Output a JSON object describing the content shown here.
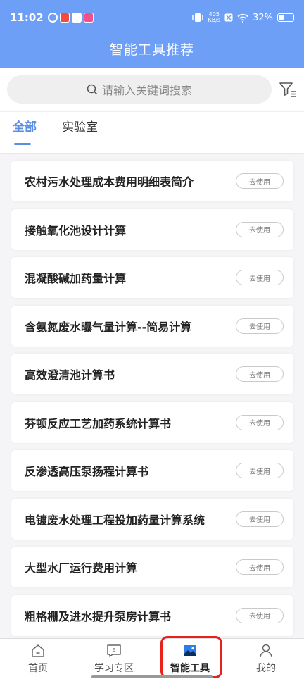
{
  "status_bar": {
    "time": "11:02",
    "speed_top": "405",
    "speed_unit": "KB/s",
    "battery": "32%"
  },
  "header": {
    "title": "智能工具推荐"
  },
  "search": {
    "placeholder": "请输入关键词搜索"
  },
  "tabs": [
    {
      "label": "全部",
      "active": true
    },
    {
      "label": "实验室",
      "active": false
    }
  ],
  "tools": [
    {
      "title": "农村污水处理成本费用明细表简介",
      "action": "去使用"
    },
    {
      "title": "接触氧化池设计计算",
      "action": "去使用"
    },
    {
      "title": "混凝酸碱加药量计算",
      "action": "去使用"
    },
    {
      "title": "含氨氮废水曝气量计算--简易计算",
      "action": "去使用"
    },
    {
      "title": "高效澄清池计算书",
      "action": "去使用"
    },
    {
      "title": "芬顿反应工艺加药系统计算书",
      "action": "去使用"
    },
    {
      "title": "反渗透高压泵扬程计算书",
      "action": "去使用"
    },
    {
      "title": "电镀废水处理工程投加药量计算系统",
      "action": "去使用"
    },
    {
      "title": "大型水厂运行费用计算",
      "action": "去使用"
    },
    {
      "title": "粗格栅及进水提升泵房计算书",
      "action": "去使用"
    }
  ],
  "bottom_nav": [
    {
      "label": "首页",
      "icon": "home-icon"
    },
    {
      "label": "学习专区",
      "icon": "study-icon"
    },
    {
      "label": "智能工具",
      "icon": "image-icon",
      "active": true
    },
    {
      "label": "我的",
      "icon": "person-icon"
    }
  ],
  "colors": {
    "header": "#6c9ff5",
    "accent": "#5b8fe6",
    "highlight": "#e8221b"
  }
}
